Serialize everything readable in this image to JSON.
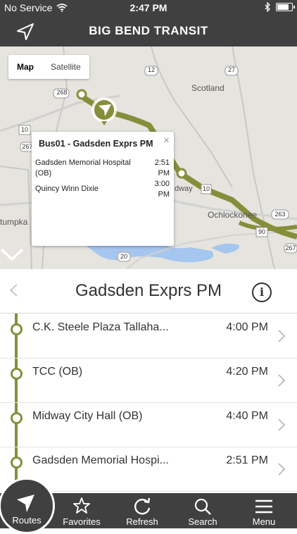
{
  "status_bar": {
    "carrier": "No Service",
    "time": "2:47 PM",
    "battery_level": 0.9
  },
  "nav": {
    "title": "BIG BEND TRANSIT"
  },
  "map": {
    "map_label": "Map",
    "satellite_label": "Satellite",
    "places": [
      "Scotland",
      "Ochlockonee",
      "dway",
      "tumpka"
    ],
    "road_shields": [
      "268",
      "12",
      "27",
      "10",
      "267",
      "263",
      "90",
      "20",
      "10",
      "267"
    ],
    "route_color": "#858f3b",
    "popup": {
      "title": "Bus01 - Gadsden Exprs PM",
      "close": "×",
      "rows": [
        {
          "name": "Gadsden Memorial Hospital (OB)",
          "time": "2:51 PM"
        },
        {
          "name": "Quincy Winn Dixie",
          "time": "3:00 PM"
        }
      ]
    }
  },
  "route": {
    "name": "Gadsden Exprs PM",
    "info_symbol": "i"
  },
  "stops": [
    {
      "name": "C.K. Steele Plaza Tallaha...",
      "time": "4:00 PM"
    },
    {
      "name": "TCC (OB)",
      "time": "4:20 PM"
    },
    {
      "name": "Midway City Hall (OB)",
      "time": "4:40 PM"
    },
    {
      "name": "Gadsden Memorial Hospi...",
      "time": "2:51 PM"
    }
  ],
  "tabs": {
    "routes": "Routes",
    "favorites": "Favorites",
    "refresh": "Refresh",
    "search": "Search",
    "menu": "Menu"
  },
  "icons": [
    "location-arrow-icon",
    "wifi-icon",
    "bluetooth-icon",
    "battery-icon",
    "bus-marker-icon",
    "chevron-down-icon",
    "chevron-left-icon",
    "info-icon",
    "chevron-right-icon",
    "routes-icon",
    "star-icon",
    "refresh-icon",
    "search-icon",
    "menu-icon"
  ]
}
